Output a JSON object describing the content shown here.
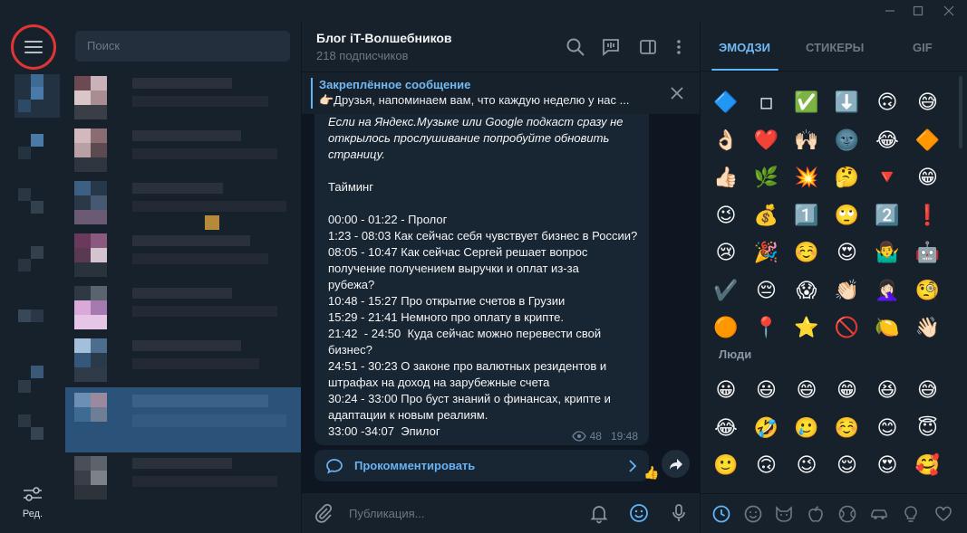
{
  "window": {
    "controls": [
      "—",
      "☐",
      "✕"
    ]
  },
  "sidebar": {
    "menu_icon": "hamburger-menu-icon",
    "edit_label": "Ред."
  },
  "chatlist": {
    "search_placeholder": "Поиск"
  },
  "chat": {
    "title": "Блог iT-Волшебников",
    "subtitle": "218 подписчиков",
    "pinned": {
      "title": "Закреплённое сообщение",
      "text": "👉🏻Друзья, напоминаем вам, что каждую неделю у нас ..."
    },
    "message": {
      "intro_italic": [
        "Если на Яндекс.Музыке или Google подкаст сразу не",
        "открылось прослушивание попробуйте обновить",
        "страницу."
      ],
      "lines": [
        "",
        "Тайминг",
        "",
        "00:00 - 01:22 - Пролог",
        "1:23 - 08:03 Как сейчас себя чувствует бизнес в России?",
        "08:05 - 10:47 Как сейчас Сергей решает вопрос",
        "получение получением выручки и оплат из-за",
        "рубежа?",
        "10:48 - 15:27 Про открытие счетов в Грузии",
        "15:29 - 21:41 Немного про оплату в крипте.",
        "21:42  - 24:50  Куда сейчас можно перевести свой",
        "бизнес?",
        "24:51 - 30:23 О законе про валютных резидентов и",
        "штрафах на доход на зарубежные счета",
        "30:24 - 33:00 Про буст знаний о финансах, крипте и",
        "адаптации к новым реалиям.",
        "33:00 -34:07  Эпилог"
      ],
      "views": "48",
      "time": "19:48",
      "comment_label": "Прокомментировать",
      "reaction": "👍"
    },
    "compose_placeholder": "Публикация..."
  },
  "emoji": {
    "tabs": [
      "ЭМОДЗИ",
      "СТИКЕРЫ",
      "GIF"
    ],
    "active_tab": 0,
    "recent": [
      [
        "🔷",
        "◽",
        "✅",
        "⬇️",
        "🙃",
        "😅"
      ],
      [
        "👌🏻",
        "❤️",
        "🙌🏻",
        "🌚",
        "😂",
        "🔶"
      ],
      [
        "👍🏻",
        "🌿",
        "💥",
        "🤔",
        "🔻",
        "😁"
      ],
      [
        "😉",
        "💰",
        "1️⃣",
        "🙄",
        "2️⃣",
        "❗"
      ],
      [
        "😢",
        "🎉",
        "☺️",
        "😍",
        "🤷‍♂️",
        "🤖"
      ],
      [
        "✔️",
        "😔",
        "😱",
        "👏🏻",
        "🤦🏻‍♀️",
        "🧐"
      ],
      [
        "🟠",
        "📍",
        "⭐",
        "🚫",
        "🍋",
        "👋🏻"
      ]
    ],
    "people_title": "Люди",
    "people": [
      [
        "😀",
        "😃",
        "😄",
        "😁",
        "😆",
        "😅"
      ],
      [
        "😂",
        "🤣",
        "🥲",
        "☺️",
        "😊",
        "😇"
      ],
      [
        "🙂",
        "🙃",
        "😉",
        "😌",
        "😍",
        "🥰"
      ]
    ],
    "categories": [
      "recent-clock-icon",
      "smiley-icon",
      "cat-icon",
      "apple-icon",
      "ball-icon",
      "car-icon",
      "lightbulb-icon",
      "heart-icon"
    ]
  },
  "colors": {
    "bg_sidebar": "#17212b",
    "bg_chat": "#0e1621",
    "bubble": "#182533",
    "accent": "#5eb5f7",
    "highlight_ring": "#e03535"
  }
}
